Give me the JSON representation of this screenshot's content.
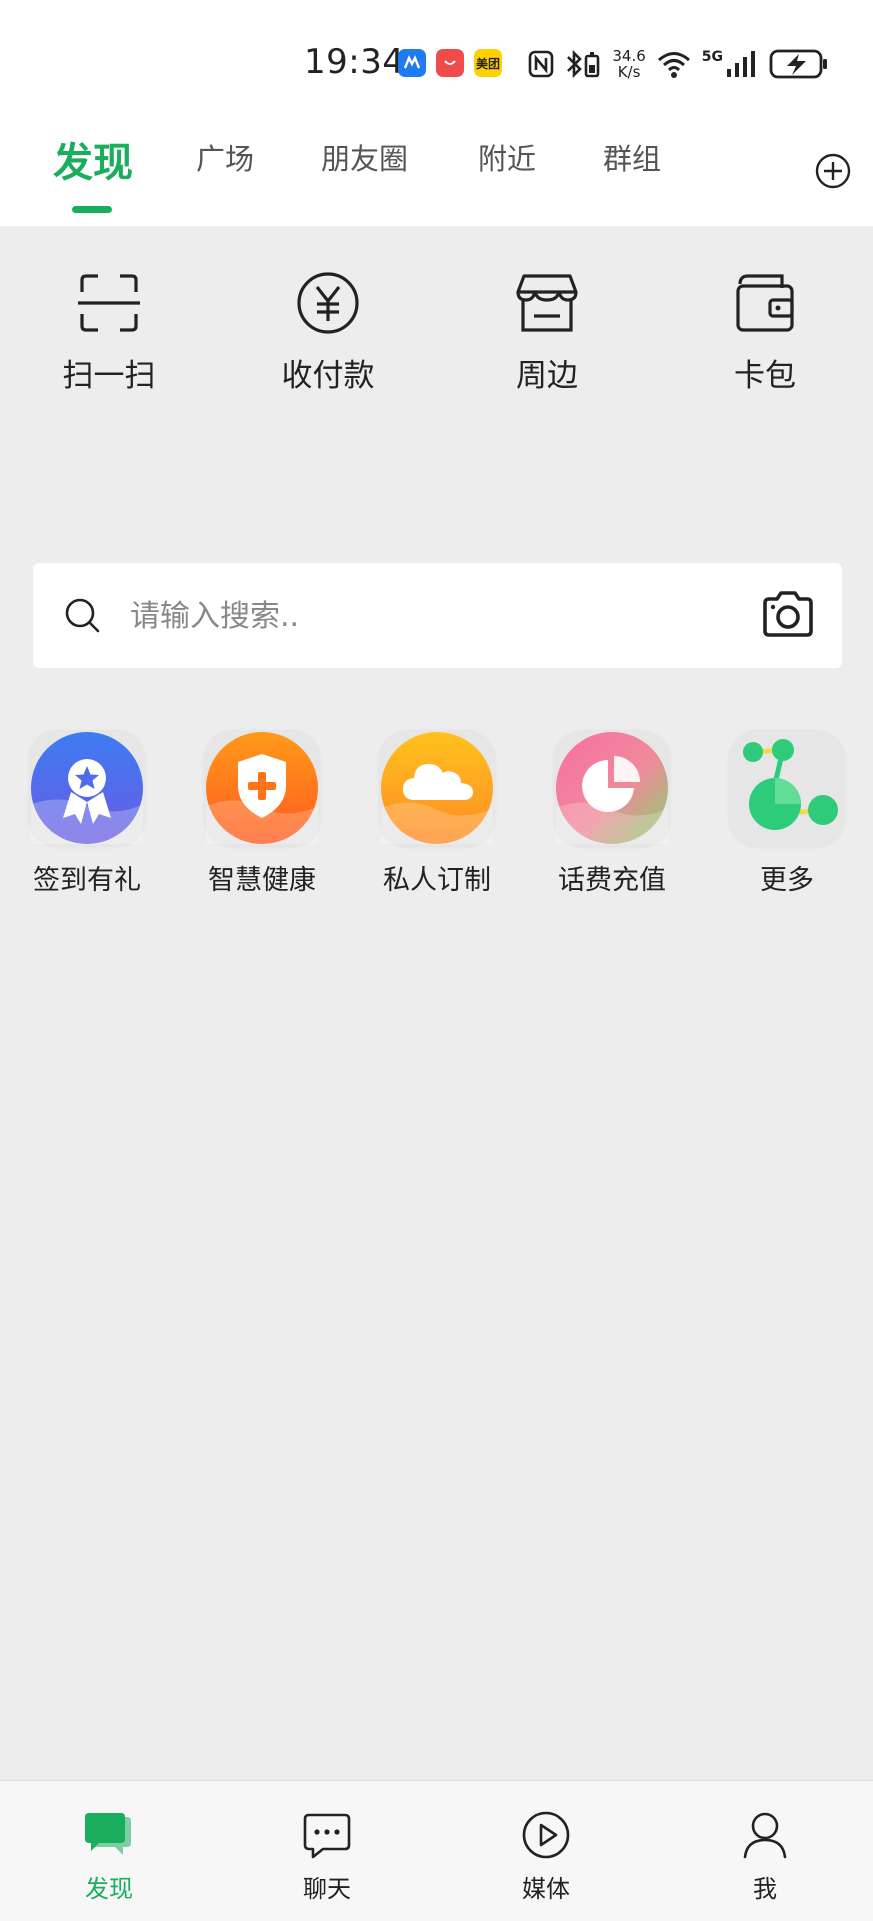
{
  "status_bar": {
    "time": "19:34",
    "network_speed_value": "34.6",
    "network_speed_unit": "K/s",
    "network_type": "5G",
    "apps": [
      {
        "name": "maps-app-icon",
        "color": "#1e7bf0"
      },
      {
        "name": "huawei-app-icon",
        "color": "#f04b4b"
      },
      {
        "name": "meituan-app-icon",
        "color": "#ffd100",
        "text": "美团"
      }
    ]
  },
  "top_tabs": {
    "items": [
      "发现",
      "广场",
      "朋友圈",
      "附近",
      "群组"
    ],
    "active_index": 0
  },
  "quick_actions": [
    {
      "label": "扫一扫",
      "icon": "scan-icon"
    },
    {
      "label": "收付款",
      "icon": "yuan-payment-icon"
    },
    {
      "label": "周边",
      "icon": "store-icon"
    },
    {
      "label": "卡包",
      "icon": "wallet-icon"
    }
  ],
  "search": {
    "placeholder": "请输入搜索.."
  },
  "services": [
    {
      "label": "签到有礼",
      "icon": "award-badge-icon"
    },
    {
      "label": "智慧健康",
      "icon": "health-shield-icon"
    },
    {
      "label": "私人订制",
      "icon": "cloud-icon"
    },
    {
      "label": "话费充值",
      "icon": "pie-chart-icon"
    },
    {
      "label": "更多",
      "icon": "more-molecule-icon"
    }
  ],
  "bottom_nav": {
    "items": [
      {
        "label": "发现",
        "icon": "discover-chat-icon"
      },
      {
        "label": "聊天",
        "icon": "chat-bubble-icon"
      },
      {
        "label": "媒体",
        "icon": "play-icon"
      },
      {
        "label": "我",
        "icon": "person-icon"
      }
    ],
    "active_index": 0
  },
  "colors": {
    "accent": "#1aad5b",
    "background": "#ededed"
  }
}
